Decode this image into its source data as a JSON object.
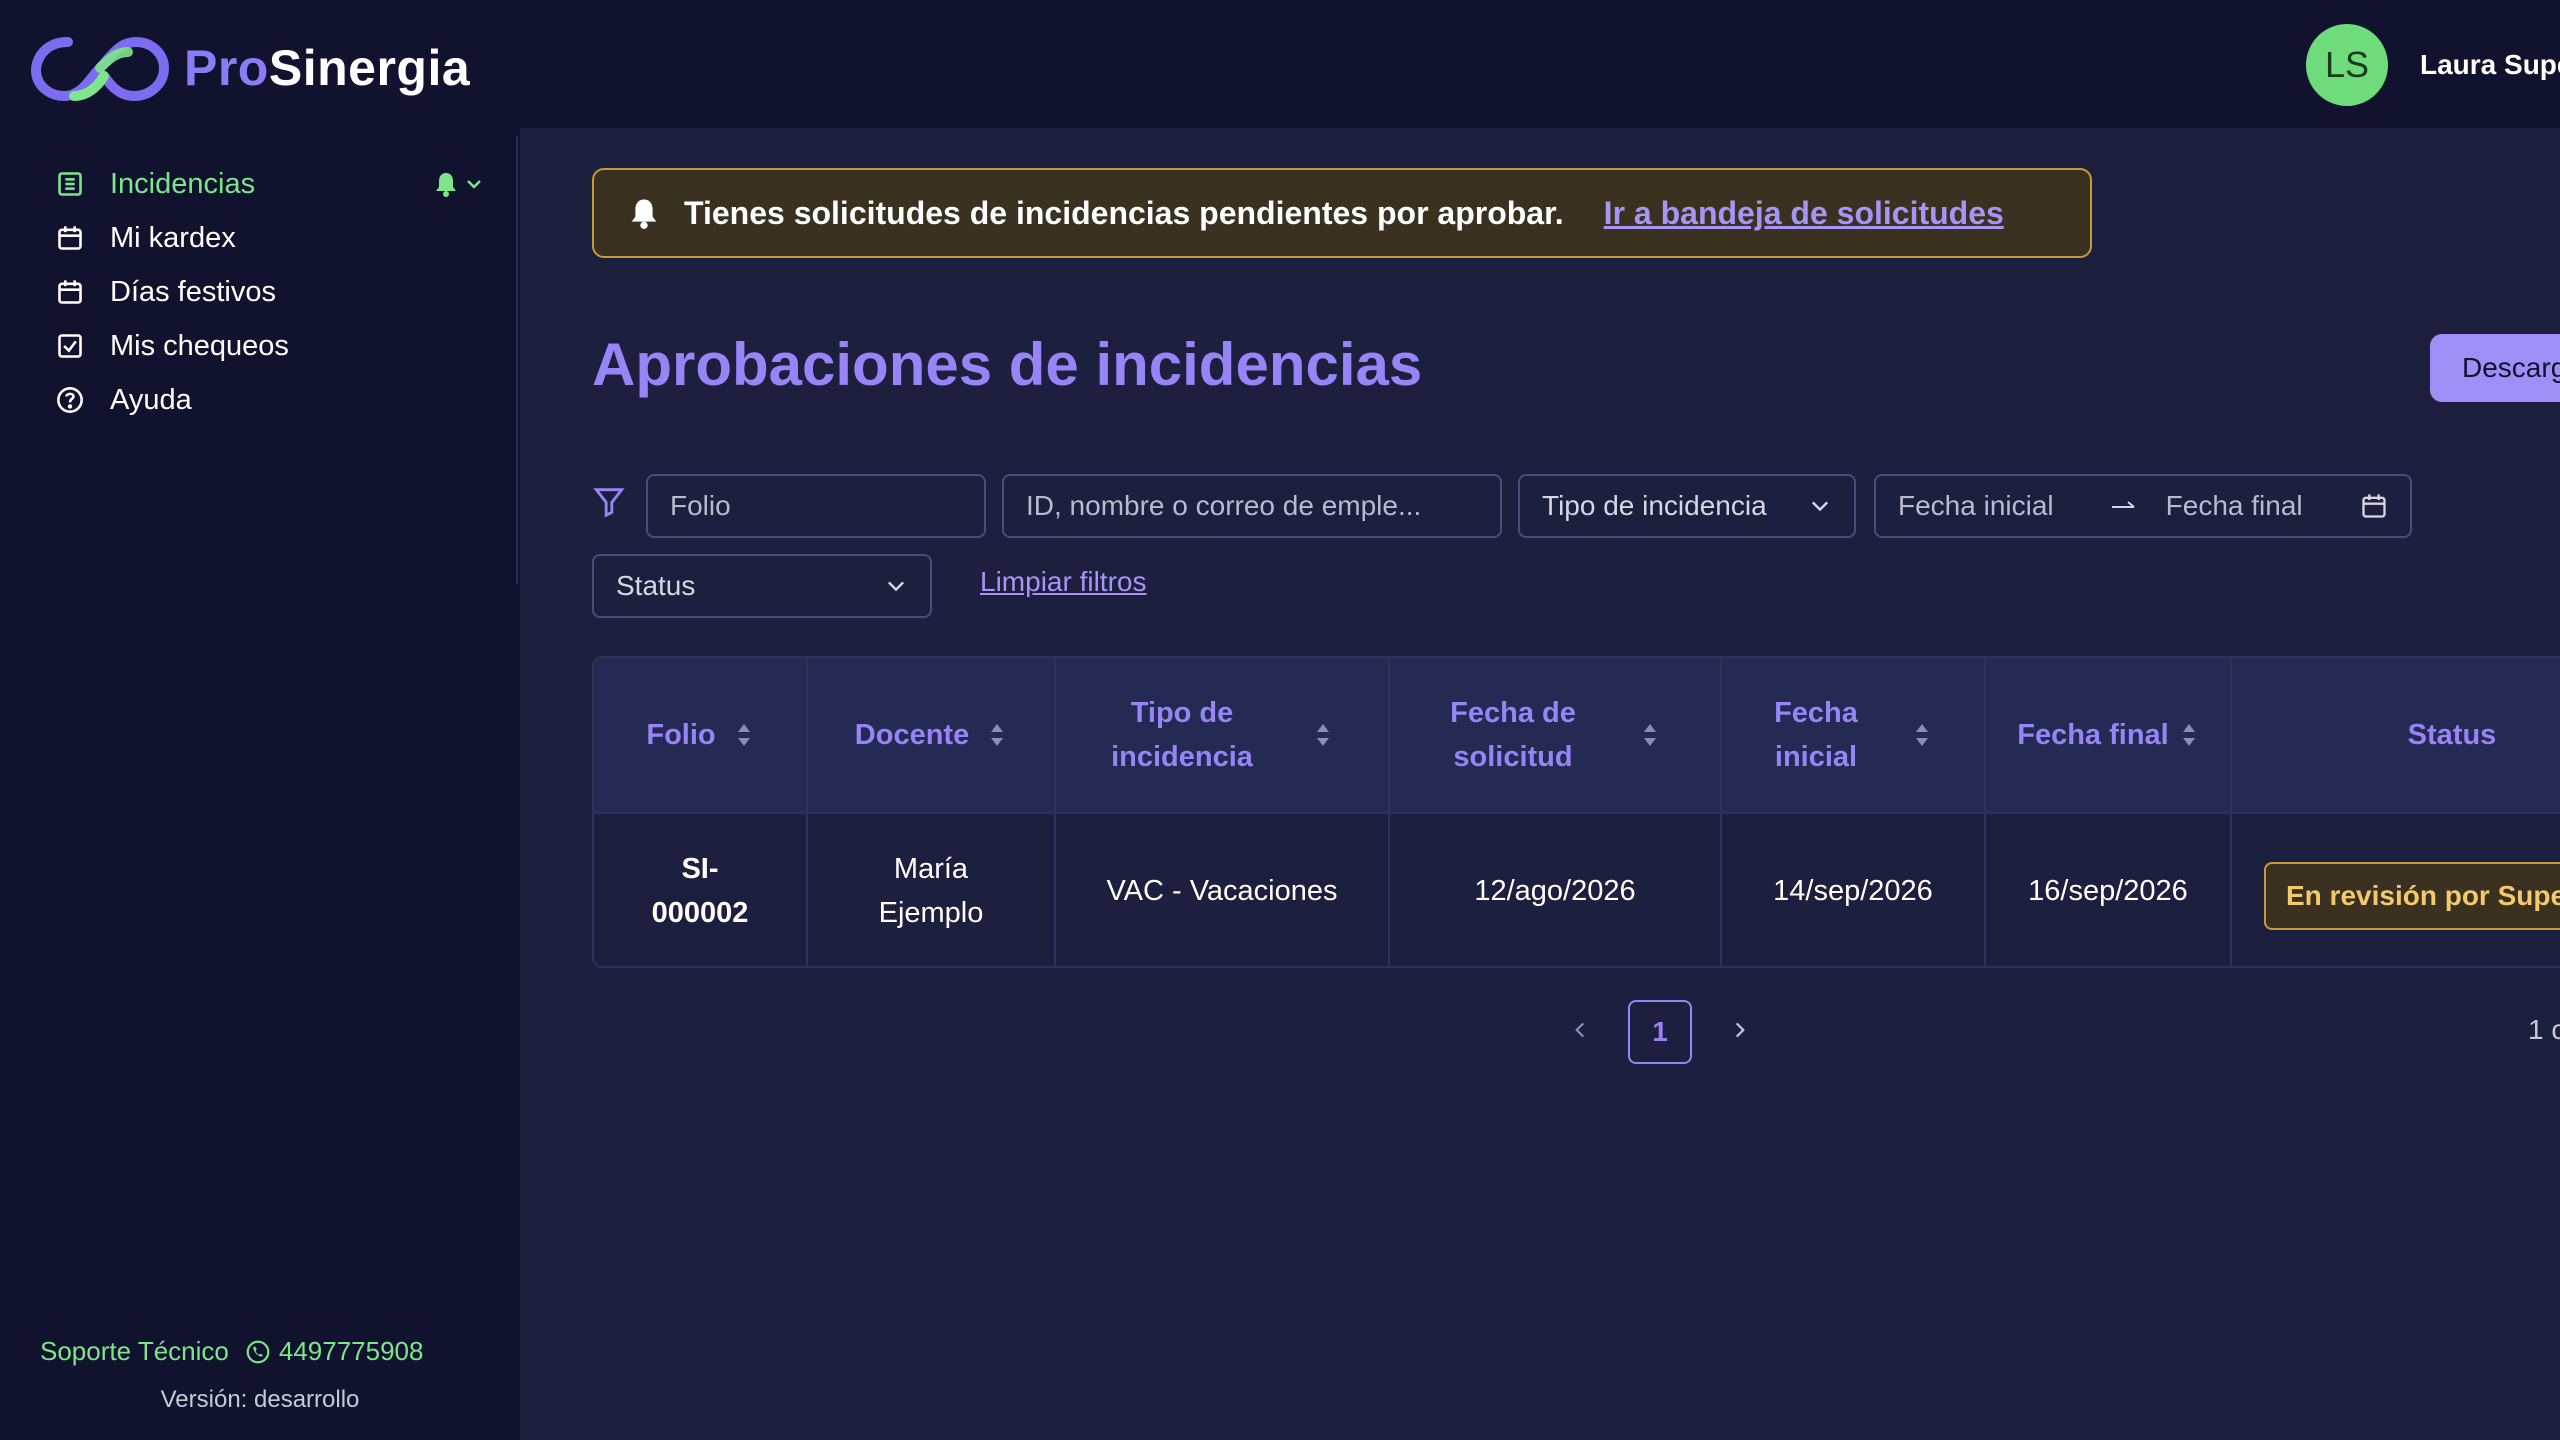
{
  "brand": {
    "pro": "Pro",
    "sinergia": "Sinergia"
  },
  "user": {
    "initials": "LS",
    "name": "Laura Supe"
  },
  "sidebar": {
    "items": [
      {
        "label": "Incidencias",
        "icon": "list-icon",
        "active": true
      },
      {
        "label": "Mi kardex",
        "icon": "calendar-icon"
      },
      {
        "label": "Días festivos",
        "icon": "calendar-icon"
      },
      {
        "label": "Mis chequeos",
        "icon": "checkbox-icon"
      },
      {
        "label": "Ayuda",
        "icon": "help-circle-icon"
      }
    ],
    "support_label": "Soporte Técnico",
    "support_phone": "4497775908",
    "version": "Versión: desarrollo"
  },
  "alert": {
    "text": "Tienes solicitudes de incidencias pendientes por aprobar.",
    "link": "Ir a bandeja de solicitudes"
  },
  "main": {
    "title": "Aprobaciones de incidencias",
    "download_label": "Descarg"
  },
  "filters": {
    "folio_placeholder": "Folio",
    "employee_placeholder": "ID, nombre o correo de emple...",
    "type_label": "Tipo de incidencia",
    "date_start": "Fecha inicial",
    "date_end": "Fecha final",
    "status_label": "Status",
    "clear_label": "Limpiar filtros"
  },
  "table": {
    "headers": {
      "folio": "Folio",
      "docente": "Docente",
      "tipo_1": "Tipo de",
      "tipo_2": "incidencia",
      "solicitud_1": "Fecha de",
      "solicitud_2": "solicitud",
      "inicial_1": "Fecha",
      "inicial_2": "inicial",
      "final": "Fecha final",
      "status": "Status"
    },
    "rows": [
      {
        "folio_1": "SI-",
        "folio_2": "000002",
        "docente_1": "María",
        "docente_2": "Ejemplo",
        "tipo": "VAC - Vacaciones",
        "fecha_solicitud": "12/ago/2026",
        "fecha_inicial": "14/sep/2026",
        "fecha_final": "16/sep/2026",
        "status": "En revisión por Supe"
      }
    ]
  },
  "pagination": {
    "current": "1",
    "total": "1 c"
  },
  "colors": {
    "accent": "#9585f6",
    "success": "#7ee58a",
    "warning": "#c79a3a",
    "background": "#1d1f3e",
    "sidebar": "#11132e"
  }
}
